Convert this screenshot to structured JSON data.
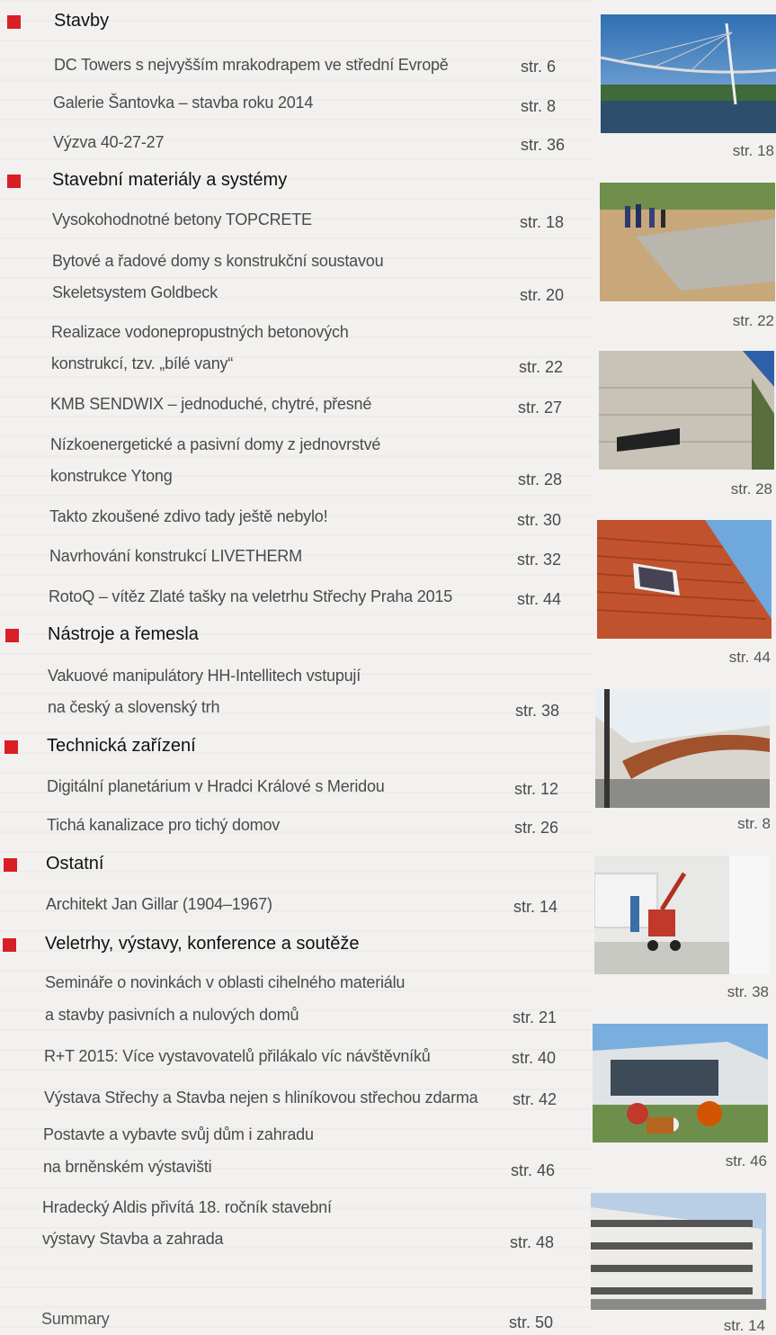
{
  "sections": [
    {
      "title": "Stavby",
      "items": [
        {
          "lines": [
            "DC Towers s nejvyšším mrakodrapem ve střední Evropě"
          ],
          "page": "str.  6"
        },
        {
          "lines": [
            "Galerie Šantovka – stavba roku 2014"
          ],
          "page": "str.  8"
        },
        {
          "lines": [
            "Výzva 40-27-27"
          ],
          "page": "str. 36"
        }
      ]
    },
    {
      "title": "Stavební materiály a systémy",
      "items": [
        {
          "lines": [
            "Vysokohodnotné betony TOPCRETE"
          ],
          "page": "str. 18"
        },
        {
          "lines": [
            "Bytové a řadové domy s konstrukční soustavou",
            "Skeletsystem Goldbeck"
          ],
          "page": "str. 20"
        },
        {
          "lines": [
            "Realizace vodonepropustných betonových",
            "konstrukcí, tzv. „bílé vany“"
          ],
          "page": "str. 22"
        },
        {
          "lines": [
            "KMB SENDWIX – jednoduché, chytré, přesné"
          ],
          "page": "str. 27"
        },
        {
          "lines": [
            "Nízkoenergetické a pasivní domy z jednovrstvé",
            "konstrukce Ytong"
          ],
          "page": "str. 28"
        },
        {
          "lines": [
            "Takto zkoušené zdivo tady ještě nebylo!"
          ],
          "page": "str. 30"
        },
        {
          "lines": [
            "Navrhování konstrukcí LIVETHERM"
          ],
          "page": "str. 32"
        },
        {
          "lines": [
            "RotoQ – vítěz Zlaté tašky na veletrhu Střechy Praha 2015"
          ],
          "page": "str. 44"
        }
      ]
    },
    {
      "title": "Nástroje a řemesla",
      "items": [
        {
          "lines": [
            "Vakuové manipulátory HH-Intellitech vstupují",
            "na český a slovenský trh"
          ],
          "page": "str. 38"
        }
      ]
    },
    {
      "title": "Technická zařízení",
      "items": [
        {
          "lines": [
            "Digitální planetárium v Hradci Králové s Meridou"
          ],
          "page": "str. 12"
        },
        {
          "lines": [
            "Tichá kanalizace pro tichý domov"
          ],
          "page": "str. 26"
        }
      ]
    },
    {
      "title": "Ostatní",
      "items": [
        {
          "lines": [
            "Architekt Jan Gillar (1904–1967)"
          ],
          "page": "str. 14"
        }
      ]
    },
    {
      "title": "Veletrhy, výstavy, konference a soutěže",
      "items": [
        {
          "lines": [
            "Semináře o novinkách v oblasti cihelného materiálu",
            "a stavby pasivních a nulových domů"
          ],
          "page": "str. 21"
        },
        {
          "lines": [
            "R+T 2015: Více vystavovatelů přilákalo víc návštěvníků"
          ],
          "page": "str. 40"
        },
        {
          "lines": [
            "Výstava Střechy a Stavba nejen s hliníkovou střechou zdarma"
          ],
          "page": "str. 42"
        },
        {
          "lines": [
            "Postavte a vybavte svůj dům i zahradu",
            "na brněnském výstavišti"
          ],
          "page": "str. 46"
        },
        {
          "lines": [
            "Hradecký Aldis přivítá 18. ročník stavební",
            "výstavy Stavba a zahrada"
          ],
          "page": "str. 48"
        }
      ]
    }
  ],
  "summary": {
    "label": "Summary",
    "page": "str. 50"
  },
  "photos": [
    {
      "icon": "bridge-photo",
      "caption": "str. 18"
    },
    {
      "icon": "construction-site-photo",
      "caption": "str. 22"
    },
    {
      "icon": "concrete-wall-photo",
      "caption": "str. 28"
    },
    {
      "icon": "tiled-roof-window-photo",
      "caption": "str. 44"
    },
    {
      "icon": "gallery-interior-photo",
      "caption": "str. 8"
    },
    {
      "icon": "vacuum-lifter-photo",
      "caption": "str. 38"
    },
    {
      "icon": "exhibition-garden-photo",
      "caption": "str. 46"
    },
    {
      "icon": "office-building-photo",
      "caption": "str. 14"
    }
  ],
  "colors": {
    "accent": "#d81f26",
    "background": "#f2f1ef",
    "text": "#4a4a4a"
  }
}
